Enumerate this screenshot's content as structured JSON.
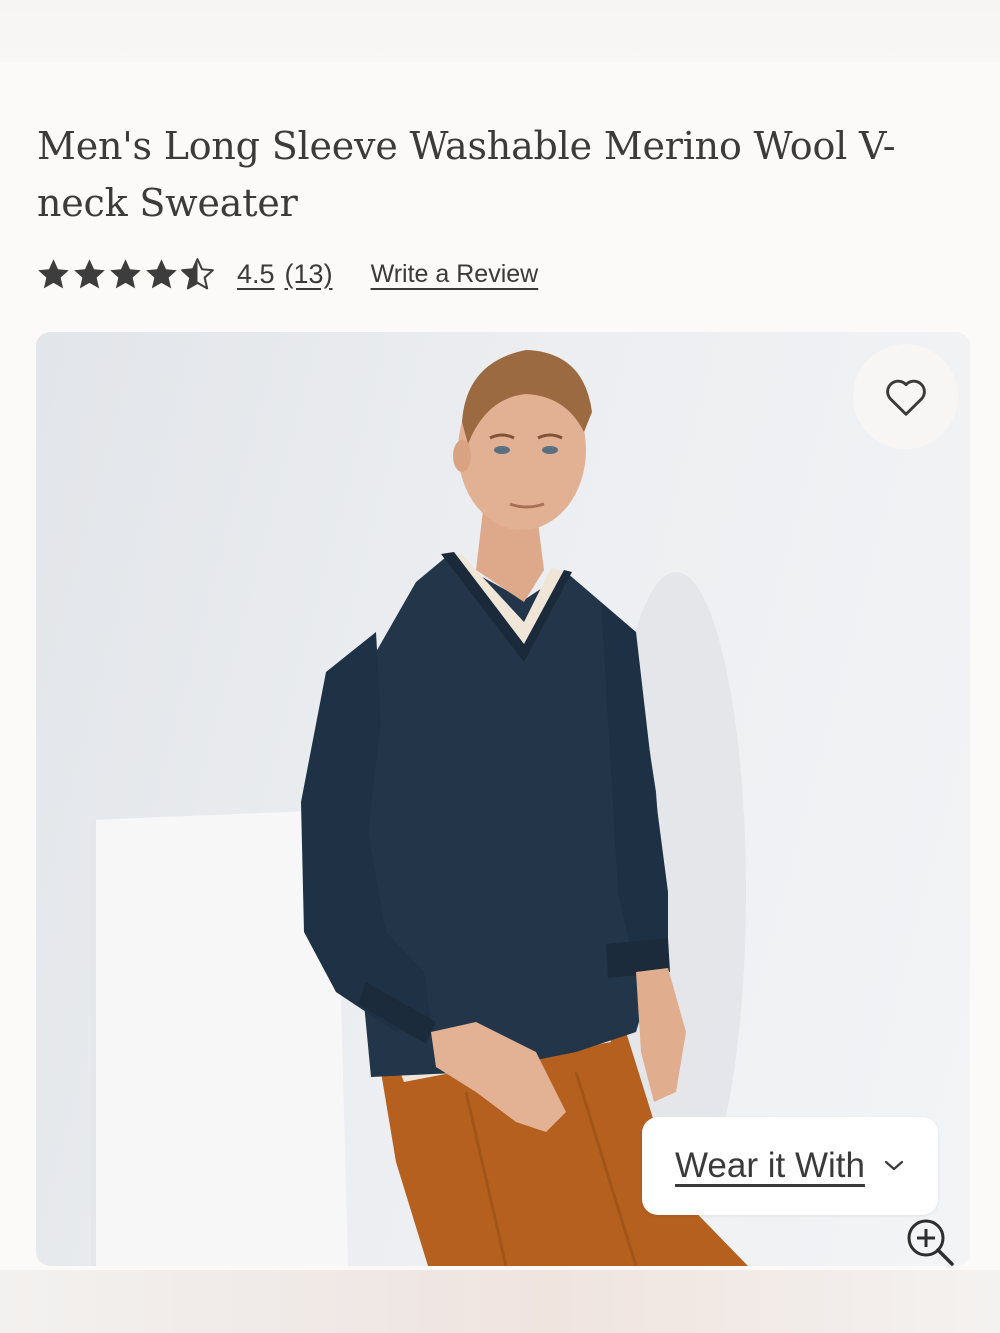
{
  "product": {
    "title": "Men's Long Sleeve Washable Merino Wool V-neck Sweater"
  },
  "rating": {
    "value": "4.5",
    "count": "(13)",
    "stars_filled_fraction": 0.9,
    "write_review_label": "Write a Review"
  },
  "hero": {
    "alt": "Man wearing navy v-neck sweater and rust corduroy pants",
    "favorite_icon": "heart-outline-icon",
    "zoom_icon": "zoom-in-icon",
    "wear_it_with_label": "Wear it With",
    "wear_it_with_icon": "chevron-down-icon"
  },
  "colors": {
    "background": "#fbfaf8",
    "text": "#3a3a3a",
    "star": "#3d3d3d",
    "sweater": "#223548",
    "pants": "#b8601e"
  }
}
